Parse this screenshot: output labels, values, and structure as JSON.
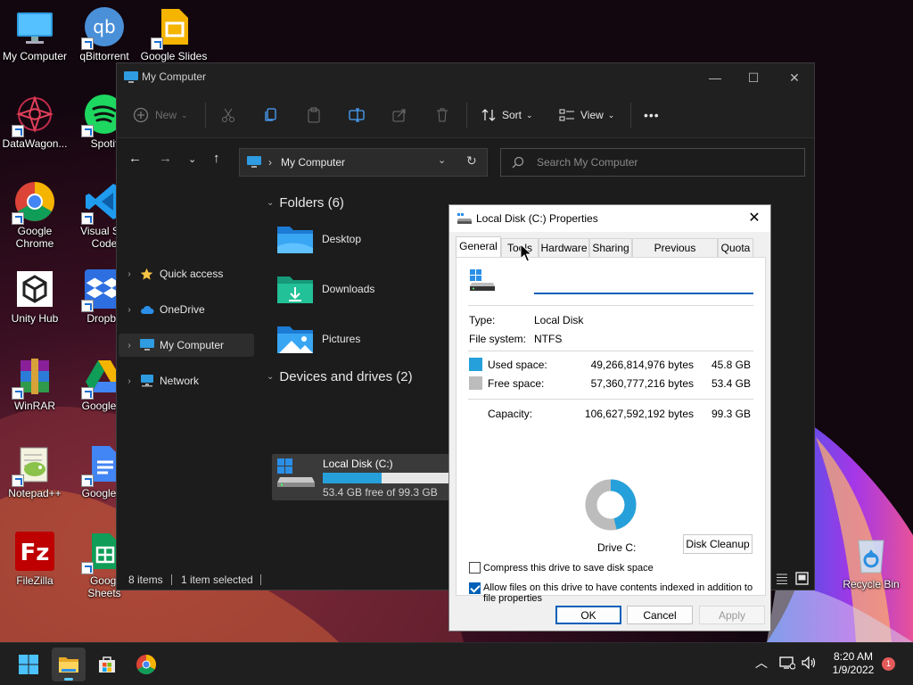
{
  "desktop": {
    "icons": [
      {
        "label": "My Computer",
        "icon": "monitor-icon"
      },
      {
        "label": "qBittorrent",
        "icon": "qbittorrent-icon"
      },
      {
        "label": "Google Slides",
        "icon": "google-slides-icon"
      },
      {
        "label": "DataWagon...",
        "icon": "datawagon-icon"
      },
      {
        "label": "Spotif",
        "icon": "spotify-icon"
      },
      {
        "label": "Google\nChrome",
        "icon": "chrome-icon"
      },
      {
        "label": "Visual Stu\nCode",
        "icon": "vscode-icon"
      },
      {
        "label": "Unity Hub",
        "icon": "unity-icon"
      },
      {
        "label": "Dropbo",
        "icon": "dropbox-icon"
      },
      {
        "label": "WinRAR",
        "icon": "winrar-icon"
      },
      {
        "label": "Google D",
        "icon": "google-drive-icon"
      },
      {
        "label": "Notepad++",
        "icon": "notepadpp-icon"
      },
      {
        "label": "Google D",
        "icon": "google-docs-icon"
      },
      {
        "label": "FileZilla",
        "icon": "filezilla-icon"
      },
      {
        "label": "Googl\nSheets",
        "icon": "google-sheets-icon"
      },
      {
        "label": "Recycle Bin",
        "icon": "recycle-bin-icon"
      }
    ]
  },
  "explorer": {
    "title": "My Computer",
    "toolbar": {
      "new": "New",
      "sort": "Sort",
      "view": "View",
      "more": "•••"
    },
    "address": "My Computer",
    "search_placeholder": "Search My Computer",
    "nav": [
      {
        "label": "Quick access"
      },
      {
        "label": "OneDrive"
      },
      {
        "label": "My Computer"
      },
      {
        "label": "Network"
      }
    ],
    "folders_header": "Folders (6)",
    "folders": [
      "Desktop",
      "Downloads",
      "Pictures"
    ],
    "drives_header": "Devices and drives (2)",
    "drive": {
      "name": "Local Disk (C:)",
      "free_text": "53.4 GB free of 99.3 GB",
      "used_fraction": 0.462
    },
    "status": {
      "items": "8 items",
      "selected": "1 item selected"
    }
  },
  "props": {
    "title": "Local Disk (C:) Properties",
    "tabs": [
      "General",
      "Tools",
      "Hardware",
      "Sharing",
      "Previous Versions",
      "Quota"
    ],
    "name_value": "",
    "type_label": "Type:",
    "type_value": "Local Disk",
    "fs_label": "File system:",
    "fs_value": "NTFS",
    "used_label": "Used space:",
    "used_bytes": "49,266,814,976 bytes",
    "used_gb": "45.8 GB",
    "free_label": "Free space:",
    "free_bytes": "57,360,777,216 bytes",
    "free_gb": "53.4 GB",
    "cap_label": "Capacity:",
    "cap_bytes": "106,627,592,192 bytes",
    "cap_gb": "99.3 GB",
    "drive_label": "Drive C:",
    "cleanup": "Disk Cleanup",
    "compress_label": "Compress this drive to save disk space",
    "compress_checked": false,
    "index_label": "Allow files on this drive to have contents indexed in addition to file properties",
    "index_checked": true,
    "ok": "OK",
    "cancel": "Cancel",
    "apply": "Apply",
    "colors": {
      "used": "#26a0da",
      "free": "#bcbcbc"
    }
  },
  "taskbar": {
    "time": "8:20 AM",
    "date": "1/9/2022",
    "notifications": "1"
  }
}
